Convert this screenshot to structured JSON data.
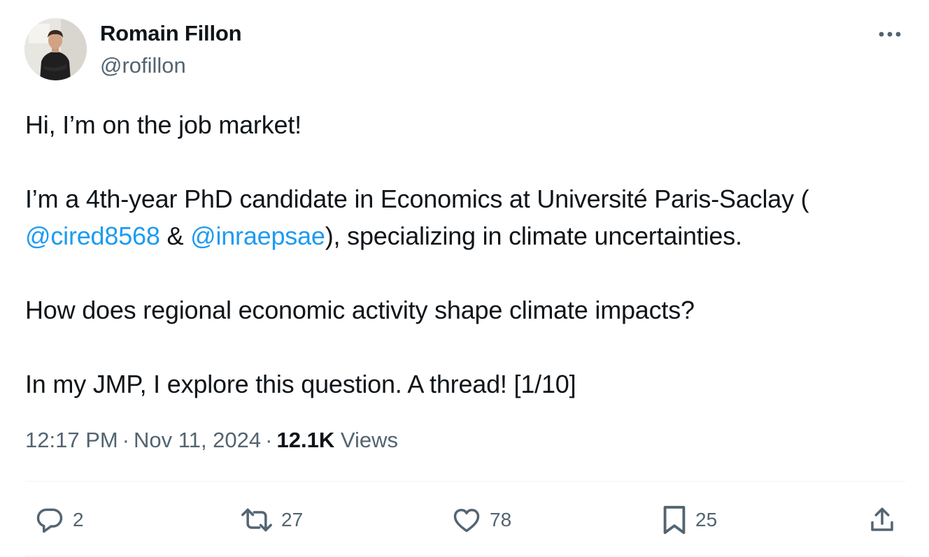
{
  "author": {
    "display_name": "Romain Fillon",
    "handle": "@rofillon"
  },
  "tweet": {
    "p1": "Hi, I’m on the job market!",
    "p2_line1": "I’m a 4th-year PhD candidate in Economics at Université Paris-Saclay (",
    "mention1": "@cired8568",
    "amp": " & ",
    "mention2": "@inraepsae",
    "p2_rest": "), specializing in climate uncertainties.",
    "p3": "How does regional economic activity shape climate impacts?",
    "p4": "In my JMP, I explore this question. A thread! [1/10]"
  },
  "meta": {
    "time": "12:17 PM",
    "date": "Nov 11, 2024",
    "separator": "·",
    "views_count": "12.1K",
    "views_label": "Views"
  },
  "actions": {
    "replies": "2",
    "reposts": "27",
    "likes": "78",
    "bookmarks": "25"
  },
  "icons": [
    "more-icon",
    "reply-icon",
    "retweet-icon",
    "like-icon",
    "bookmark-icon",
    "share-icon"
  ],
  "colors": {
    "text": "#0f1419",
    "secondary": "#536471",
    "link": "#1d9bf0",
    "divider": "#eff3f4"
  }
}
